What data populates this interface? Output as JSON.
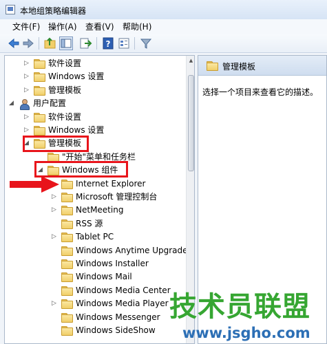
{
  "window": {
    "title": "本地组策略编辑器"
  },
  "menu": [
    "文件(F)",
    "操作(A)",
    "查看(V)",
    "帮助(H)"
  ],
  "toolbar": {
    "buttons": [
      "back-icon",
      "forward-icon",
      "up-folder-icon",
      "show-hide-tree-icon",
      "export-list-icon",
      "help-icon",
      "properties-icon",
      "filter-icon"
    ]
  },
  "tree": [
    {
      "label": "软件设置",
      "level": 2,
      "expander": "collapsed",
      "icon": "folder"
    },
    {
      "label": "Windows 设置",
      "level": 2,
      "expander": "collapsed",
      "icon": "folder"
    },
    {
      "label": "管理模板",
      "level": 2,
      "expander": "collapsed",
      "icon": "folder"
    },
    {
      "label": "用户配置",
      "level": 1,
      "expander": "expanded",
      "icon": "user"
    },
    {
      "label": "软件设置",
      "level": 2,
      "expander": "collapsed",
      "icon": "folder"
    },
    {
      "label": "Windows 设置",
      "level": 2,
      "expander": "collapsed",
      "icon": "folder"
    },
    {
      "label": "管理模板",
      "level": 2,
      "expander": "expanded",
      "icon": "folder",
      "highlighted": true
    },
    {
      "label": "\"开始\"菜单和任务栏",
      "level": 3,
      "expander": "none",
      "icon": "folder"
    },
    {
      "label": "Windows 组件",
      "level": 3,
      "expander": "expanded",
      "icon": "folder",
      "highlighted": true
    },
    {
      "label": "Internet Explorer",
      "level": 4,
      "expander": "none",
      "icon": "folder",
      "arrow": true
    },
    {
      "label": "Microsoft 管理控制台",
      "level": 4,
      "expander": "collapsed",
      "icon": "folder"
    },
    {
      "label": "NetMeeting",
      "level": 4,
      "expander": "collapsed",
      "icon": "folder"
    },
    {
      "label": "RSS 源",
      "level": 4,
      "expander": "none",
      "icon": "folder"
    },
    {
      "label": "Tablet PC",
      "level": 4,
      "expander": "collapsed",
      "icon": "folder"
    },
    {
      "label": "Windows Anytime Upgrade",
      "level": 4,
      "expander": "none",
      "icon": "folder"
    },
    {
      "label": "Windows Installer",
      "level": 4,
      "expander": "none",
      "icon": "folder"
    },
    {
      "label": "Windows Mail",
      "level": 4,
      "expander": "none",
      "icon": "folder"
    },
    {
      "label": "Windows Media Center",
      "level": 4,
      "expander": "none",
      "icon": "folder"
    },
    {
      "label": "Windows Media Player",
      "level": 4,
      "expander": "collapsed",
      "icon": "folder"
    },
    {
      "label": "Windows Messenger",
      "level": 4,
      "expander": "none",
      "icon": "folder"
    },
    {
      "label": "Windows SideShow",
      "level": 4,
      "expander": "none",
      "icon": "folder"
    }
  ],
  "right_pane": {
    "header": "管理模板",
    "description": "选择一个项目来查看它的描述。"
  },
  "watermark": {
    "logo_text": "技术员联盟",
    "url": "www.jsgho.com"
  },
  "colors": {
    "highlight_red": "#e8141b",
    "watermark_green": "#36a632",
    "watermark_blue": "#2c6fb5"
  }
}
